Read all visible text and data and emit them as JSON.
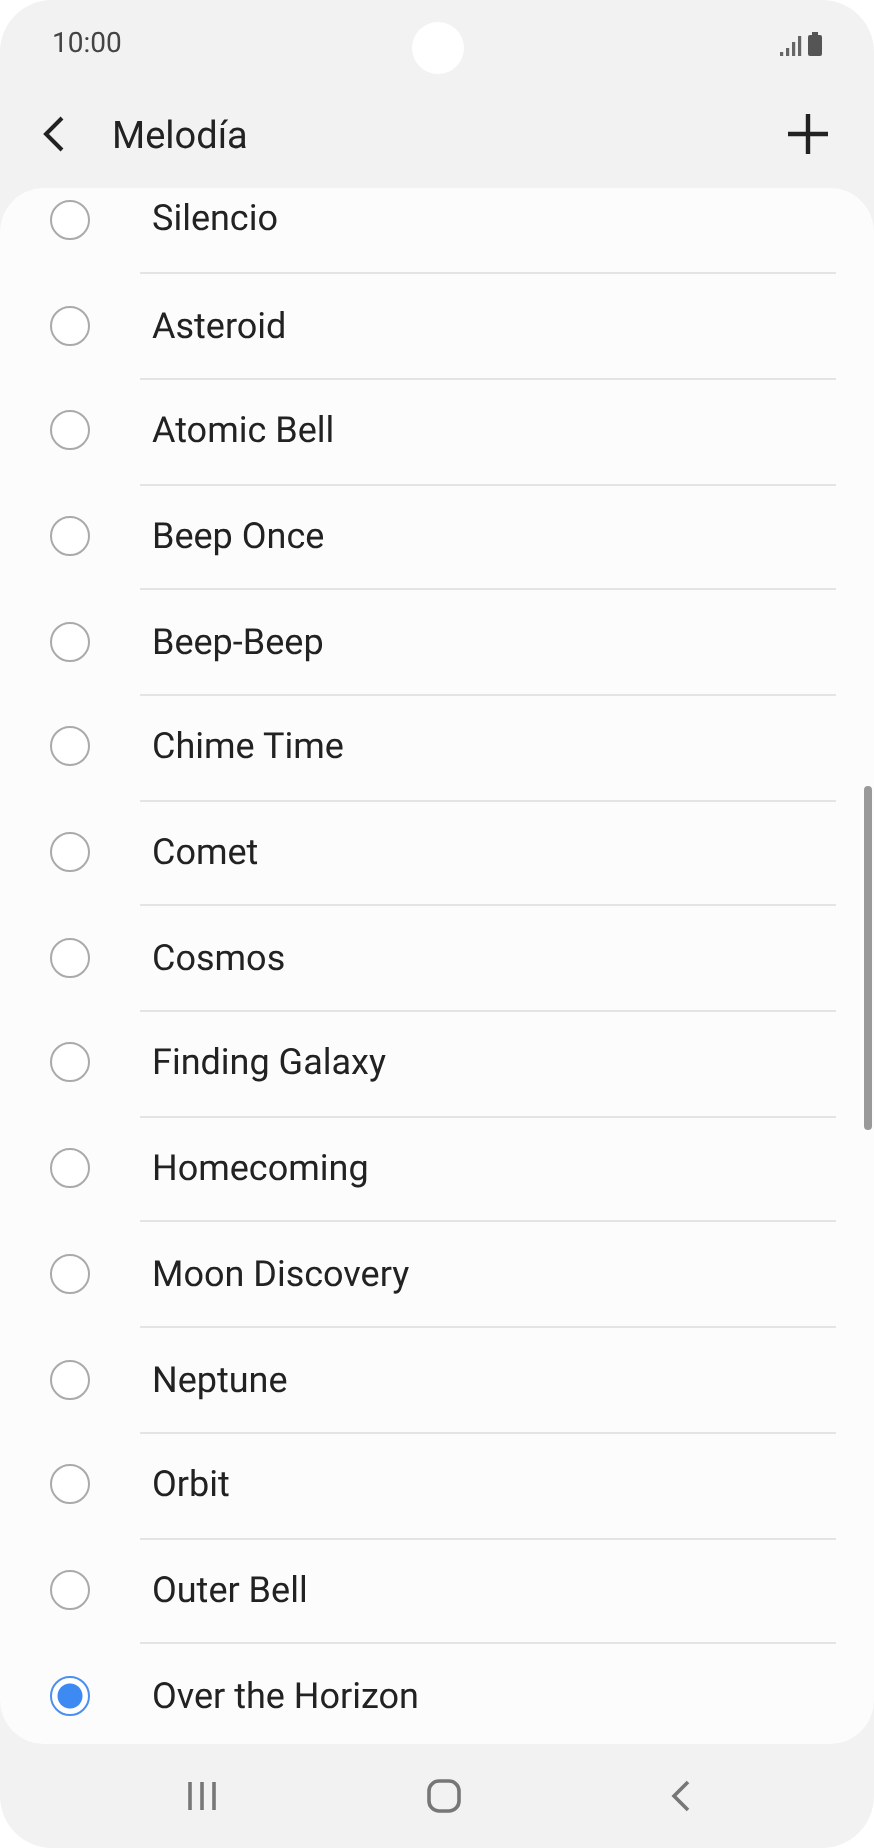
{
  "status_bar": {
    "time": "10:00"
  },
  "header": {
    "title": "Melodía"
  },
  "ringtones": [
    {
      "label": "Silencio",
      "selected": false
    },
    {
      "label": "Asteroid",
      "selected": false
    },
    {
      "label": "Atomic Bell",
      "selected": false
    },
    {
      "label": "Beep Once",
      "selected": false
    },
    {
      "label": "Beep-Beep",
      "selected": false
    },
    {
      "label": "Chime Time",
      "selected": false
    },
    {
      "label": "Comet",
      "selected": false
    },
    {
      "label": "Cosmos",
      "selected": false
    },
    {
      "label": "Finding Galaxy",
      "selected": false
    },
    {
      "label": "Homecoming",
      "selected": false
    },
    {
      "label": "Moon Discovery",
      "selected": false
    },
    {
      "label": "Neptune",
      "selected": false
    },
    {
      "label": "Orbit",
      "selected": false
    },
    {
      "label": "Outer Bell",
      "selected": false
    },
    {
      "label": "Over the Horizon",
      "selected": true
    }
  ]
}
